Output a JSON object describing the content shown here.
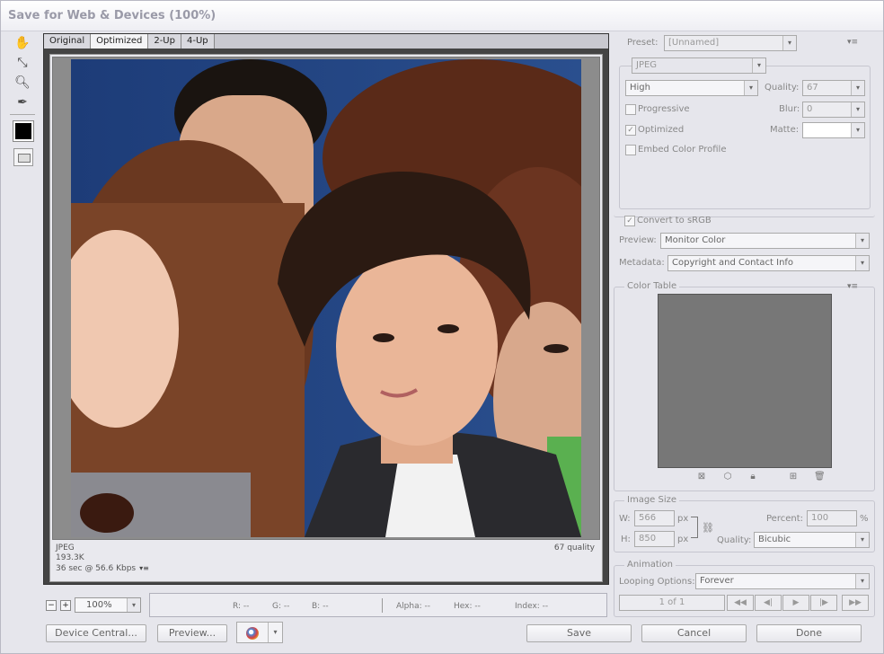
{
  "window": {
    "title": "Save for Web & Devices (100%)"
  },
  "tabs": [
    "Original",
    "Optimized",
    "2-Up",
    "4-Up"
  ],
  "image_info": {
    "format": "JPEG",
    "size": "193.3K",
    "time": "36 sec @ 56.6 Kbps",
    "quality_label": "67 quality"
  },
  "zoom": {
    "minus": "−",
    "plus": "+",
    "value": "100%"
  },
  "readouts": {
    "r": "R: --",
    "g": "G: --",
    "b": "B: --",
    "alpha": "Alpha: --",
    "hex": "Hex: --",
    "index": "Index: --"
  },
  "buttons": {
    "device_central": "Device Central...",
    "preview": "Preview...",
    "save": "Save",
    "cancel": "Cancel",
    "done": "Done"
  },
  "preset": {
    "label": "Preset:",
    "value": "[Unnamed]"
  },
  "format": {
    "value": "JPEG"
  },
  "quality_preset": {
    "value": "High"
  },
  "quality": {
    "label": "Quality:",
    "value": "67"
  },
  "progressive": {
    "label": "Progressive",
    "checked": false
  },
  "blur": {
    "label": "Blur:",
    "value": "0"
  },
  "optimized": {
    "label": "Optimized",
    "checked": true
  },
  "matte": {
    "label": "Matte:"
  },
  "embed_profile": {
    "label": "Embed Color Profile",
    "checked": false
  },
  "convert_srgb": {
    "label": "Convert to sRGB",
    "checked": true
  },
  "preview_mode": {
    "label": "Preview:",
    "value": "Monitor Color"
  },
  "metadata": {
    "label": "Metadata:",
    "value": "Copyright and Contact Info"
  },
  "color_table": {
    "title": "Color Table"
  },
  "image_size": {
    "title": "Image Size",
    "w_label": "W:",
    "w_value": "566",
    "h_label": "H:",
    "h_value": "850",
    "unit": "px",
    "percent_label": "Percent:",
    "percent_value": "100",
    "percent_unit": "%",
    "quality_label": "Quality:",
    "quality_value": "Bicubic"
  },
  "animation": {
    "title": "Animation",
    "looping_label": "Looping Options:",
    "looping_value": "Forever",
    "frame_counter": "1 of 1"
  },
  "icons": {
    "check": "✓",
    "dropdown": "▾",
    "menu": "▾≡"
  }
}
